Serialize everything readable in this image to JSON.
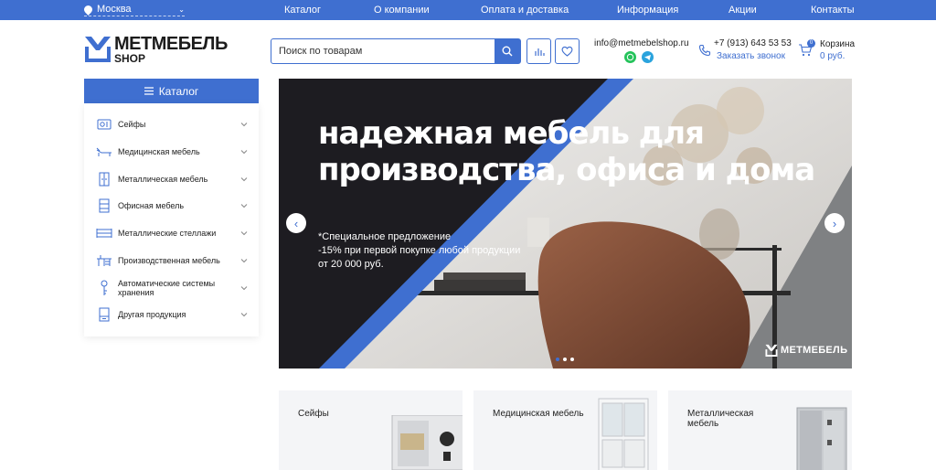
{
  "topbar": {
    "city": "Москва",
    "nav": [
      "Каталог",
      "О компании",
      "Оплата и доставка",
      "Информация",
      "Акции",
      "Контакты"
    ]
  },
  "header": {
    "logo_main": "МЕТМЕБЕЛЬ",
    "logo_sub": "SHOP",
    "search_placeholder": "Поиск по товарам",
    "email": "info@metmebelshop.ru",
    "phone": "+7 (913) 643 53 53",
    "callback": "Заказать звонок",
    "cart_label": "Корзина",
    "cart_sum": "0 руб.",
    "cart_count": "0"
  },
  "catalog": {
    "title": "Каталог",
    "items": [
      {
        "label": "Сейфы",
        "icon": "safe-icon"
      },
      {
        "label": "Медицинская мебель",
        "icon": "medical-bed-icon"
      },
      {
        "label": "Металлическая мебель",
        "icon": "cabinet-icon"
      },
      {
        "label": "Офисная мебель",
        "icon": "office-cabinet-icon"
      },
      {
        "label": "Металлические стеллажи",
        "icon": "shelving-icon"
      },
      {
        "label": "Производственная мебель",
        "icon": "workbench-icon"
      },
      {
        "label": "Автоматические системы хранения",
        "icon": "key-icon"
      },
      {
        "label": "Другая продукция",
        "icon": "box-icon"
      }
    ]
  },
  "banner": {
    "title": "надежная мебель для производства, офиса и дома",
    "offer_1": "*Специальное предложение",
    "offer_2": "-15% при первой покупке любой продукции",
    "offer_3": "от 20 000 руб.",
    "watermark": "МЕТМЕБЕЛЬ",
    "slides": 3,
    "active_slide": 1
  },
  "cards": [
    "Сейфы",
    "Медицинская мебель",
    "Металлическая мебель"
  ],
  "colors": {
    "accent": "#3f6fd0",
    "dark": "#1d1c21",
    "card_bg": "#f4f5f7"
  }
}
